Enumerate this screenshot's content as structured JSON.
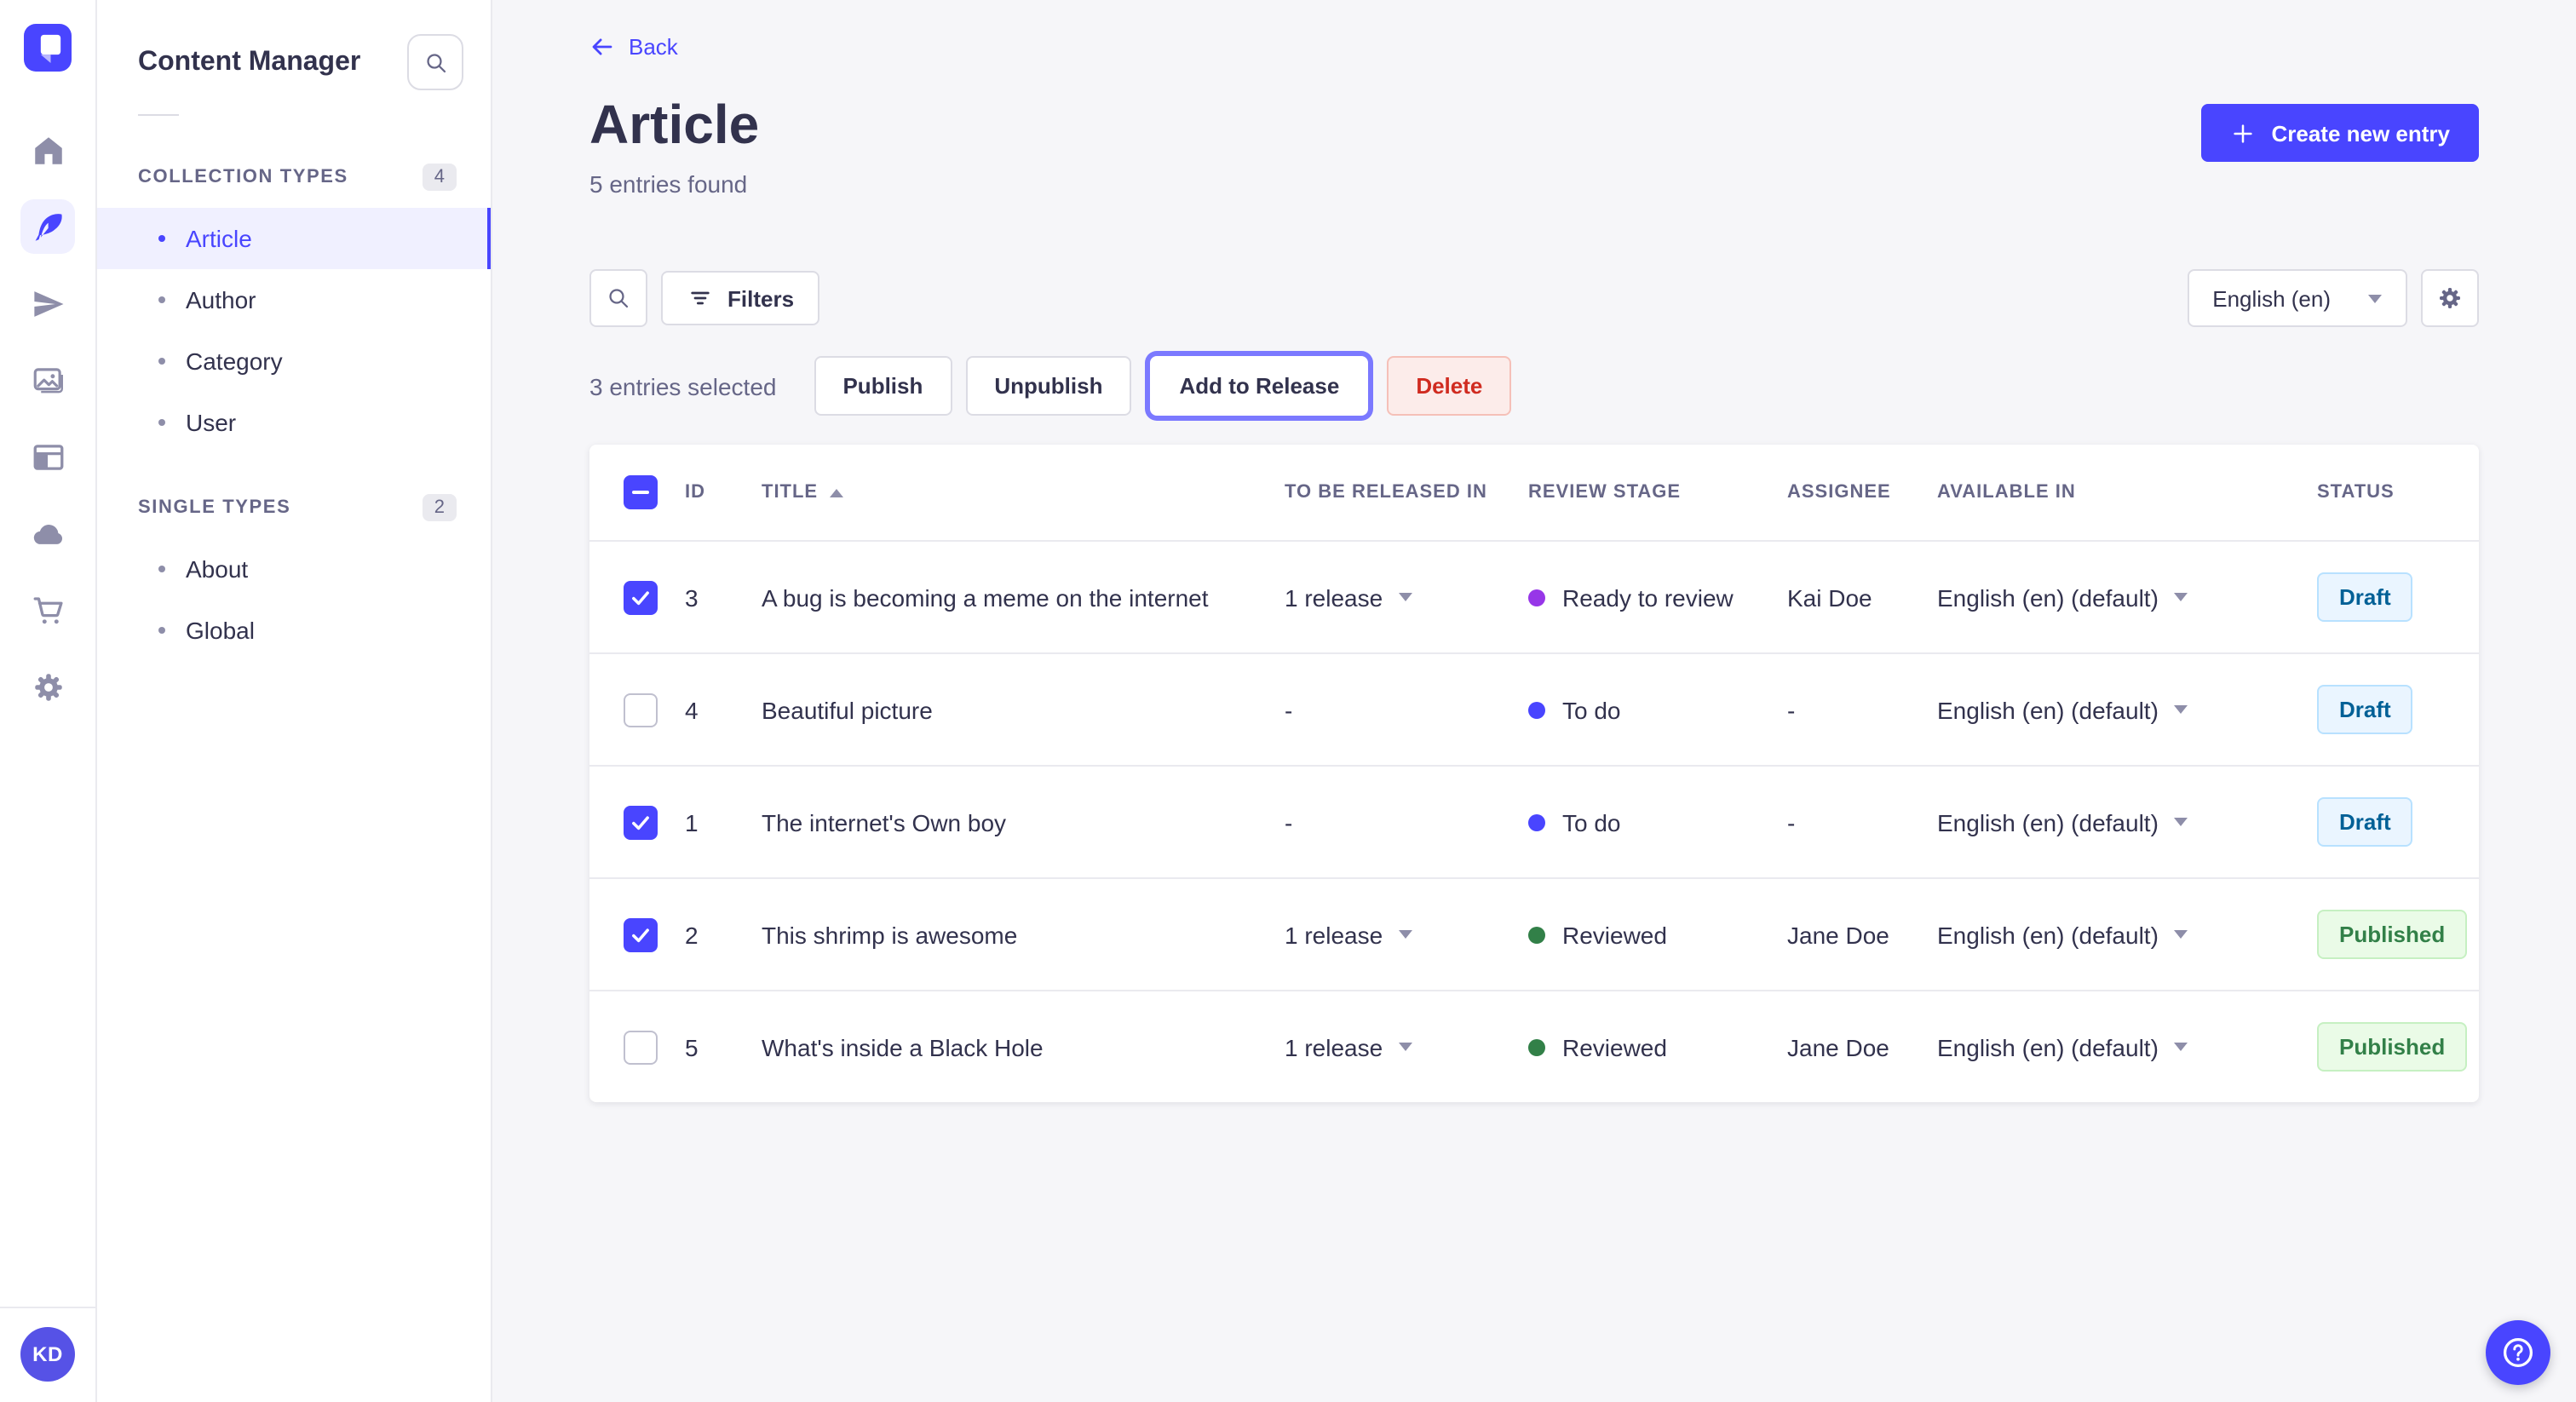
{
  "app": {
    "name": "Strapi admin",
    "colors": {
      "primary": "#4945ff",
      "primary_light_bg": "#f0f0ff",
      "page_bg": "#f6f6f9",
      "border": "#dcdce4",
      "text": "#32324d",
      "muted_text": "#666687",
      "danger_text": "#d02b20",
      "danger_bg": "#fcecea",
      "focus_ring": "#7b79ff",
      "draft_bg": "#eaf5ff",
      "draft_text": "#006096",
      "published_bg": "#eafbe7",
      "published_text": "#328048"
    }
  },
  "nav_rail": {
    "icons": [
      "home-icon",
      "feather-icon",
      "paper-plane-icon",
      "media-icon",
      "layout-icon",
      "cloud-icon",
      "cart-icon",
      "gear-icon"
    ],
    "active_icon": "feather-icon"
  },
  "user": {
    "initials": "KD"
  },
  "sidebar": {
    "title": "Content Manager",
    "sections": [
      {
        "label": "COLLECTION TYPES",
        "count": "4",
        "items": [
          {
            "label": "Article",
            "active": true
          },
          {
            "label": "Author",
            "active": false
          },
          {
            "label": "Category",
            "active": false
          },
          {
            "label": "User",
            "active": false
          }
        ]
      },
      {
        "label": "SINGLE TYPES",
        "count": "2",
        "items": [
          {
            "label": "About",
            "active": false
          },
          {
            "label": "Global",
            "active": false
          }
        ]
      }
    ]
  },
  "header": {
    "back_label": "Back",
    "title": "Article",
    "subtitle": "5 entries found",
    "create_button": "Create new entry"
  },
  "toolbar": {
    "filters_label": "Filters",
    "locale_value": "English (en)"
  },
  "selection": {
    "text": "3 entries selected",
    "publish": "Publish",
    "unpublish": "Unpublish",
    "add_to_release": "Add to Release",
    "delete": "Delete"
  },
  "table": {
    "columns": [
      "ID",
      "TITLE",
      "TO BE RELEASED IN",
      "REVIEW STAGE",
      "ASSIGNEE",
      "AVAILABLE IN",
      "STATUS"
    ],
    "sorted_column": "TITLE",
    "sort_direction": "asc",
    "rows": [
      {
        "checked": true,
        "id": "3",
        "title": "A bug is becoming a meme on the internet",
        "release": "1 release",
        "stage": "Ready to review",
        "stage_color": "#9736e8",
        "assignee": "Kai Doe",
        "locale": "English (en) (default)",
        "status": "Draft"
      },
      {
        "checked": false,
        "id": "4",
        "title": "Beautiful picture",
        "release": "-",
        "stage": "To do",
        "stage_color": "#4945ff",
        "assignee": "-",
        "locale": "English (en) (default)",
        "status": "Draft"
      },
      {
        "checked": true,
        "id": "1",
        "title": "The internet's Own boy",
        "release": "-",
        "stage": "To do",
        "stage_color": "#4945ff",
        "assignee": "-",
        "locale": "English (en) (default)",
        "status": "Draft"
      },
      {
        "checked": true,
        "id": "2",
        "title": "This shrimp is awesome",
        "release": "1 release",
        "stage": "Reviewed",
        "stage_color": "#328048",
        "assignee": "Jane Doe",
        "locale": "English (en) (default)",
        "status": "Published"
      },
      {
        "checked": false,
        "id": "5",
        "title": "What's inside a Black Hole",
        "release": "1 release",
        "stage": "Reviewed",
        "stage_color": "#328048",
        "assignee": "Jane Doe",
        "locale": "English (en) (default)",
        "status": "Published"
      }
    ]
  },
  "help": {
    "icon": "question-mark-icon"
  }
}
